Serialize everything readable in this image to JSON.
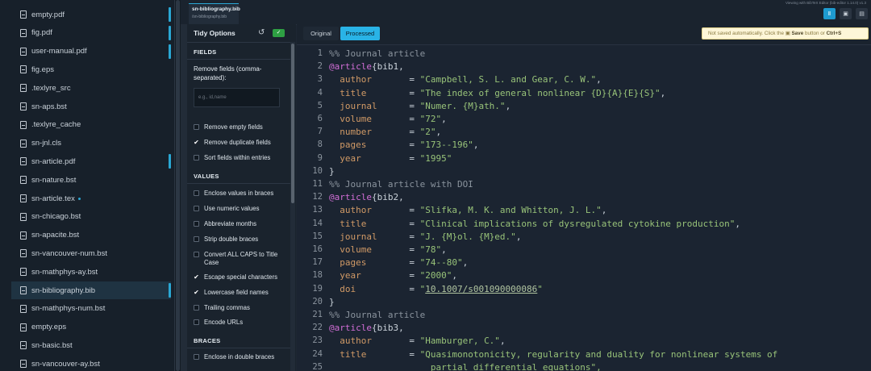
{
  "filetree": {
    "files": [
      {
        "name": "empty.pdf",
        "indicator": true
      },
      {
        "name": "fig.pdf",
        "indicator": true
      },
      {
        "name": "user-manual.pdf",
        "indicator": true
      },
      {
        "name": "fig.eps"
      },
      {
        "name": ".texlyre_src"
      },
      {
        "name": "sn-aps.bst"
      },
      {
        "name": ".texlyre_cache"
      },
      {
        "name": "sn-jnl.cls"
      },
      {
        "name": "sn-article.pdf",
        "indicator": true
      },
      {
        "name": "sn-nature.bst"
      },
      {
        "name": "sn-article.tex",
        "modified": true
      },
      {
        "name": "sn-chicago.bst"
      },
      {
        "name": "sn-apacite.bst"
      },
      {
        "name": "sn-vancouver-num.bst"
      },
      {
        "name": "sn-mathphys-ay.bst"
      },
      {
        "name": "sn-bibliography.bib",
        "active": true,
        "indicator": true
      },
      {
        "name": "sn-mathphys-num.bst"
      },
      {
        "name": "empty.eps"
      },
      {
        "name": "sn-basic.bst"
      },
      {
        "name": "sn-vancouver-ay.bst"
      }
    ]
  },
  "tab": {
    "title": "sn-bibliography.bib",
    "path": "/sn-bibliography.bib"
  },
  "header": {
    "viewing_text": "Viewing with BibTeX Editor (bib-editor 1.14.0) v1.3",
    "buttons": [
      {
        "icon": "tidy-icon",
        "label": "Ⅱ"
      },
      {
        "icon": "save-icon",
        "label": "▣"
      },
      {
        "icon": "export-icon",
        "label": "▤"
      }
    ]
  },
  "tidy": {
    "title": "Tidy Options",
    "undo_icon": "↺",
    "run_label": "✓",
    "sections": {
      "fields": "FIELDS",
      "values": "VALUES",
      "braces": "BRACES"
    },
    "remove_fields_label": "Remove fields (comma-separated):",
    "remove_fields_placeholder": "e.g., id,name",
    "field_options": [
      {
        "label": "Remove empty fields",
        "checked": false
      },
      {
        "label": "Remove duplicate fields",
        "checked": true
      },
      {
        "label": "Sort fields within entries",
        "checked": false
      }
    ],
    "value_options": [
      {
        "label": "Enclose values in braces",
        "checked": false
      },
      {
        "label": "Use numeric values",
        "checked": false
      },
      {
        "label": "Abbreviate months",
        "checked": false
      },
      {
        "label": "Strip double braces",
        "checked": false
      },
      {
        "label": "Convert ALL CAPS to Title Case",
        "checked": false
      },
      {
        "label": "Escape special characters",
        "checked": true
      },
      {
        "label": "Lowercase field names",
        "checked": true
      },
      {
        "label": "Trailing commas",
        "checked": false
      },
      {
        "label": "Encode URLs",
        "checked": false
      }
    ],
    "brace_options": [
      {
        "label": "Enclose in double braces",
        "checked": false
      }
    ]
  },
  "editor": {
    "modes": {
      "original": "Original",
      "processed": "Processed"
    },
    "notice_prefix": "Not saved automatically. Click the ",
    "notice_save": "Save",
    "notice_mid": " button or ",
    "notice_shortcut": "Ctrl+S",
    "lines": [
      {
        "n": "1",
        "kind": "comment",
        "text": "%% Journal article"
      },
      {
        "n": "2",
        "kind": "entry",
        "type": "@article",
        "id": "bib1"
      },
      {
        "n": "3",
        "kind": "field",
        "key": "author",
        "value": "Campbell, S. L. and Gear, C. W."
      },
      {
        "n": "4",
        "kind": "field",
        "key": "title",
        "value": "The index of general nonlinear {D}{A}{E}{S}"
      },
      {
        "n": "5",
        "kind": "field",
        "key": "journal",
        "value": "Numer. {M}ath."
      },
      {
        "n": "6",
        "kind": "field",
        "key": "volume",
        "value": "72"
      },
      {
        "n": "7",
        "kind": "field",
        "key": "number",
        "value": "2"
      },
      {
        "n": "8",
        "kind": "field",
        "key": "pages",
        "value": "173--196"
      },
      {
        "n": "9",
        "kind": "field",
        "key": "year",
        "value": "1995",
        "last": true
      },
      {
        "n": "10",
        "kind": "close",
        "text": "}"
      },
      {
        "n": "11",
        "kind": "comment",
        "text": "%% Journal article with DOI"
      },
      {
        "n": "12",
        "kind": "entry",
        "type": "@article",
        "id": "bib2"
      },
      {
        "n": "13",
        "kind": "field",
        "key": "author",
        "value": "Slifka, M. K. and Whitton, J. L."
      },
      {
        "n": "14",
        "kind": "field",
        "key": "title",
        "value": "Clinical implications of dysregulated cytokine production"
      },
      {
        "n": "15",
        "kind": "field",
        "key": "journal",
        "value": "J. {M}ol. {M}ed."
      },
      {
        "n": "16",
        "kind": "field",
        "key": "volume",
        "value": "78"
      },
      {
        "n": "17",
        "kind": "field",
        "key": "pages",
        "value": "74--80"
      },
      {
        "n": "18",
        "kind": "field",
        "key": "year",
        "value": "2000"
      },
      {
        "n": "19",
        "kind": "field",
        "key": "doi",
        "value": "10.1007/s001090000086",
        "link": true,
        "last": true
      },
      {
        "n": "20",
        "kind": "close",
        "text": "}"
      },
      {
        "n": "21",
        "kind": "comment",
        "text": "%% Journal article"
      },
      {
        "n": "22",
        "kind": "entry",
        "type": "@article",
        "id": "bib3"
      },
      {
        "n": "23",
        "kind": "field",
        "key": "author",
        "value": "Hamburger, C."
      },
      {
        "n": "24",
        "kind": "field",
        "key": "title",
        "value": "Quasimonotonicity, regularity and duality for nonlinear systems of",
        "open": true
      },
      {
        "n": "25",
        "kind": "cont",
        "text": "partial differential equations"
      }
    ]
  }
}
